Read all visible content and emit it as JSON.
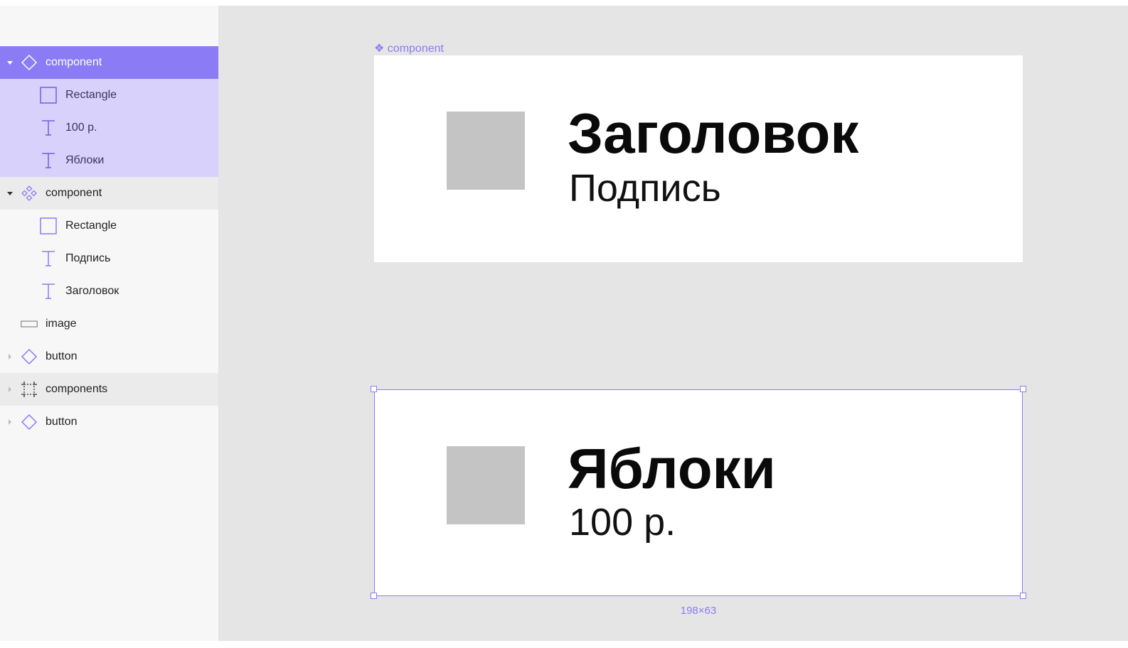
{
  "layers": [
    {
      "label": "component",
      "icon": "component-main-icon",
      "state": "selected",
      "expanded": true
    },
    {
      "label": "Rectangle",
      "icon": "rectangle-icon",
      "state": "selected-child"
    },
    {
      "label": "100 р.",
      "icon": "text-icon",
      "state": "selected-child"
    },
    {
      "label": "Яблоки",
      "icon": "text-icon",
      "state": "selected-child"
    },
    {
      "label": "component",
      "icon": "component-set-icon",
      "state": "hover",
      "expanded": true
    },
    {
      "label": "Rectangle",
      "icon": "rectangle-icon",
      "state": "normal"
    },
    {
      "label": "Подпись",
      "icon": "text-icon",
      "state": "normal"
    },
    {
      "label": "Заголовок",
      "icon": "text-icon",
      "state": "normal"
    },
    {
      "label": "image",
      "icon": "image-frame-icon",
      "state": "normal"
    },
    {
      "label": "button",
      "icon": "component-instance-icon",
      "state": "normal",
      "expanded": false
    },
    {
      "label": "components",
      "icon": "frame-icon",
      "state": "hover",
      "expanded": false
    },
    {
      "label": "button",
      "icon": "component-instance-icon",
      "state": "normal",
      "expanded": false
    }
  ],
  "canvas": {
    "frame_label": "❖ component",
    "master": {
      "title": "Заголовок",
      "subtitle": "Подпись"
    },
    "instance": {
      "title": "Яблоки",
      "subtitle": "100 р."
    },
    "selection_size": "198×63"
  },
  "colors": {
    "accent": "#8b7cf6",
    "selected_row": "#8b7cf6",
    "selected_child_row": "#d8d1fb",
    "canvas_bg": "#e5e5e5",
    "placeholder": "#c4c4c4"
  }
}
